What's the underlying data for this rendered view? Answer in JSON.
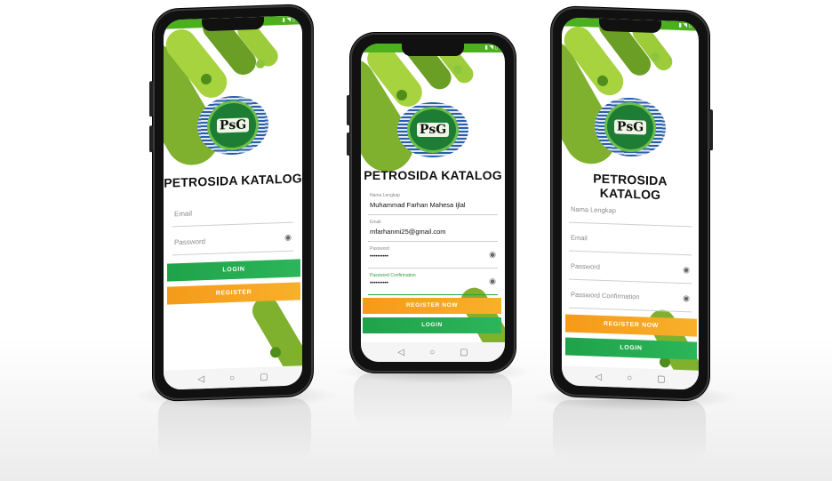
{
  "app": {
    "title": "PETROSIDA KATALOG",
    "logo_text": "PsG"
  },
  "status": {
    "time": "",
    "icons": "▮ ◥ ▯"
  },
  "nav": {
    "back": "◁",
    "home": "○",
    "recent": "▢"
  },
  "login_screen": {
    "email_placeholder": "Email",
    "password_placeholder": "Password",
    "login_label": "LOGIN",
    "register_label": "REGISTER"
  },
  "register_filled": {
    "fullname_label": "Nama Lengkap",
    "fullname_value": "Muhammad Farhan Mahesa Ijlal",
    "email_label": "Email",
    "email_value": "mfarhanmi25@gmail.com",
    "password_label": "Password",
    "password_value": "••••••••••",
    "confirm_label": "Password Confirmation",
    "confirm_value": "••••••••••",
    "register_now_label": "REGISTER NOW",
    "login_label": "LOGIN"
  },
  "register_empty": {
    "fullname_placeholder": "Nama Lengkap",
    "email_placeholder": "Email",
    "password_placeholder": "Password",
    "confirm_placeholder": "Password Confirmation",
    "register_now_label": "REGISTER NOW",
    "login_label": "LOGIN"
  },
  "colors": {
    "green": "#1fa34a",
    "orange": "#f59a1a",
    "lime": "#8cc63f",
    "olive": "#5a7d1a"
  }
}
